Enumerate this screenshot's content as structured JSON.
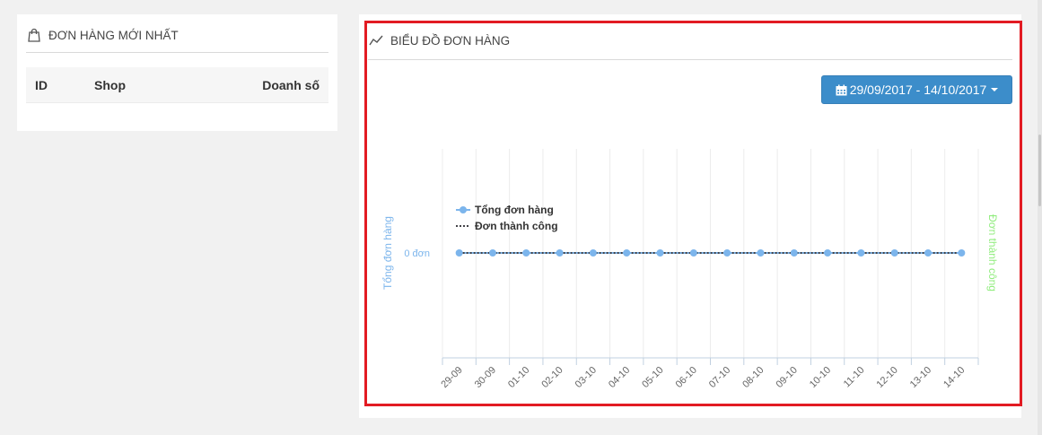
{
  "orders_panel": {
    "title": "ĐƠN HÀNG MỚI NHẤT",
    "columns": [
      "ID",
      "Shop",
      "Doanh số"
    ]
  },
  "chart_panel": {
    "title": "BIỂU ĐỒ ĐƠN HÀNG",
    "date_range": "29/09/2017 - 14/10/2017"
  },
  "icons": {
    "orders": "shopping-bag-icon",
    "chart": "line-chart-icon",
    "date": "calendar-icon",
    "dropdown": "caret-down-icon"
  },
  "colors": {
    "accent": "#3c8dca",
    "series_total": "#7cb5ec",
    "series_success": "#434348",
    "right_axis": "#90ed7d",
    "highlight": "#e21b23"
  },
  "chart_data": {
    "type": "line",
    "categories": [
      "29-09",
      "30-09",
      "01-10",
      "02-10",
      "03-10",
      "04-10",
      "05-10",
      "06-10",
      "07-10",
      "08-10",
      "09-10",
      "10-10",
      "11-10",
      "12-10",
      "13-10",
      "14-10"
    ],
    "series": [
      {
        "name": "Tổng đơn hàng",
        "values": [
          0,
          0,
          0,
          0,
          0,
          0,
          0,
          0,
          0,
          0,
          0,
          0,
          0,
          0,
          0,
          0
        ],
        "style": "solid-markers"
      },
      {
        "name": "Đơn thành công",
        "values": [
          0,
          0,
          0,
          0,
          0,
          0,
          0,
          0,
          0,
          0,
          0,
          0,
          0,
          0,
          0,
          0
        ],
        "style": "dotted"
      }
    ],
    "ylabel_left": "Tổng đơn hàng",
    "ylabel_right": "Đơn thành công",
    "y_tick_labels": [
      "0 đơn"
    ],
    "grid": "vertical",
    "legend": "top-left"
  }
}
